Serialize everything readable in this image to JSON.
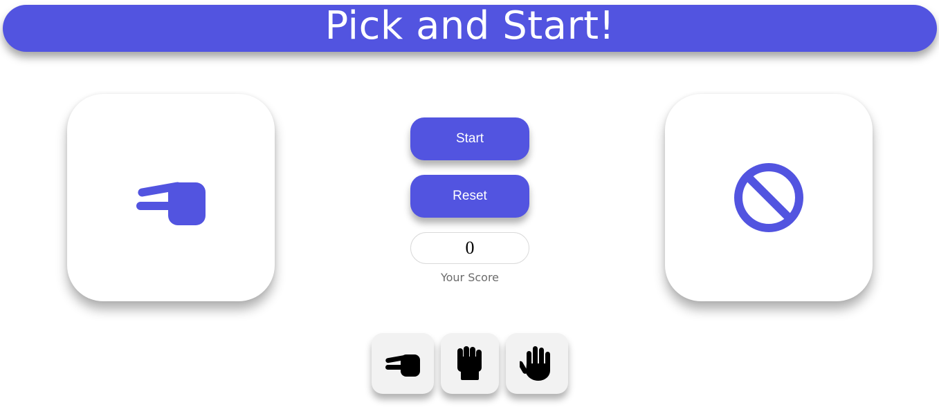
{
  "header": {
    "title": "Pick and Start!"
  },
  "player_card": {
    "icon": "scissors-hand-icon"
  },
  "computer_card": {
    "icon": "ban-icon"
  },
  "controls": {
    "start_label": "Start",
    "reset_label": "Reset"
  },
  "score": {
    "value": "0",
    "label": "Your Score"
  },
  "choices": [
    {
      "name": "scissors",
      "icon": "scissors-hand-icon"
    },
    {
      "name": "rock",
      "icon": "fist-icon"
    },
    {
      "name": "paper",
      "icon": "open-hand-icon"
    }
  ],
  "colors": {
    "accent": "#5254e0",
    "choice_bg": "#f2f2f2",
    "icon_dark": "#000000"
  }
}
